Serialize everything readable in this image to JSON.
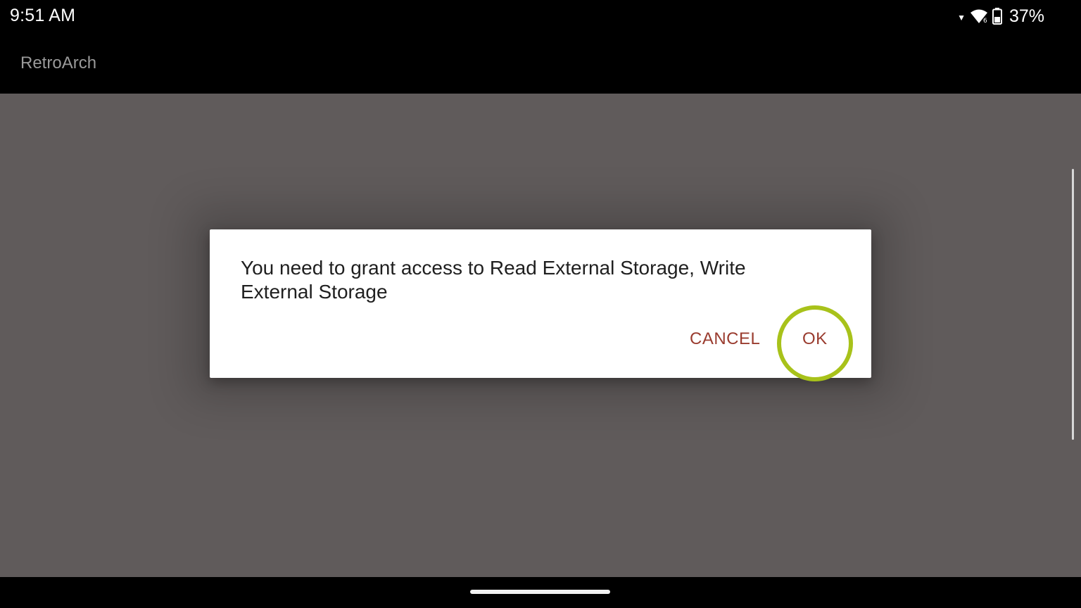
{
  "status_bar": {
    "time": "9:51 AM",
    "battery_percent": "37%",
    "icons": [
      "signal-caret-icon",
      "wifi-icon",
      "battery-icon"
    ]
  },
  "app_bar": {
    "title": "RetroArch"
  },
  "dialog": {
    "message": "You need to grant access to Read External Storage, Write External Storage",
    "cancel_label": "CANCEL",
    "ok_label": "OK"
  },
  "colors": {
    "dialog_button_text": "#9a3c2f",
    "highlight_ring": "#a8c21a",
    "content_background": "#605b5b"
  }
}
